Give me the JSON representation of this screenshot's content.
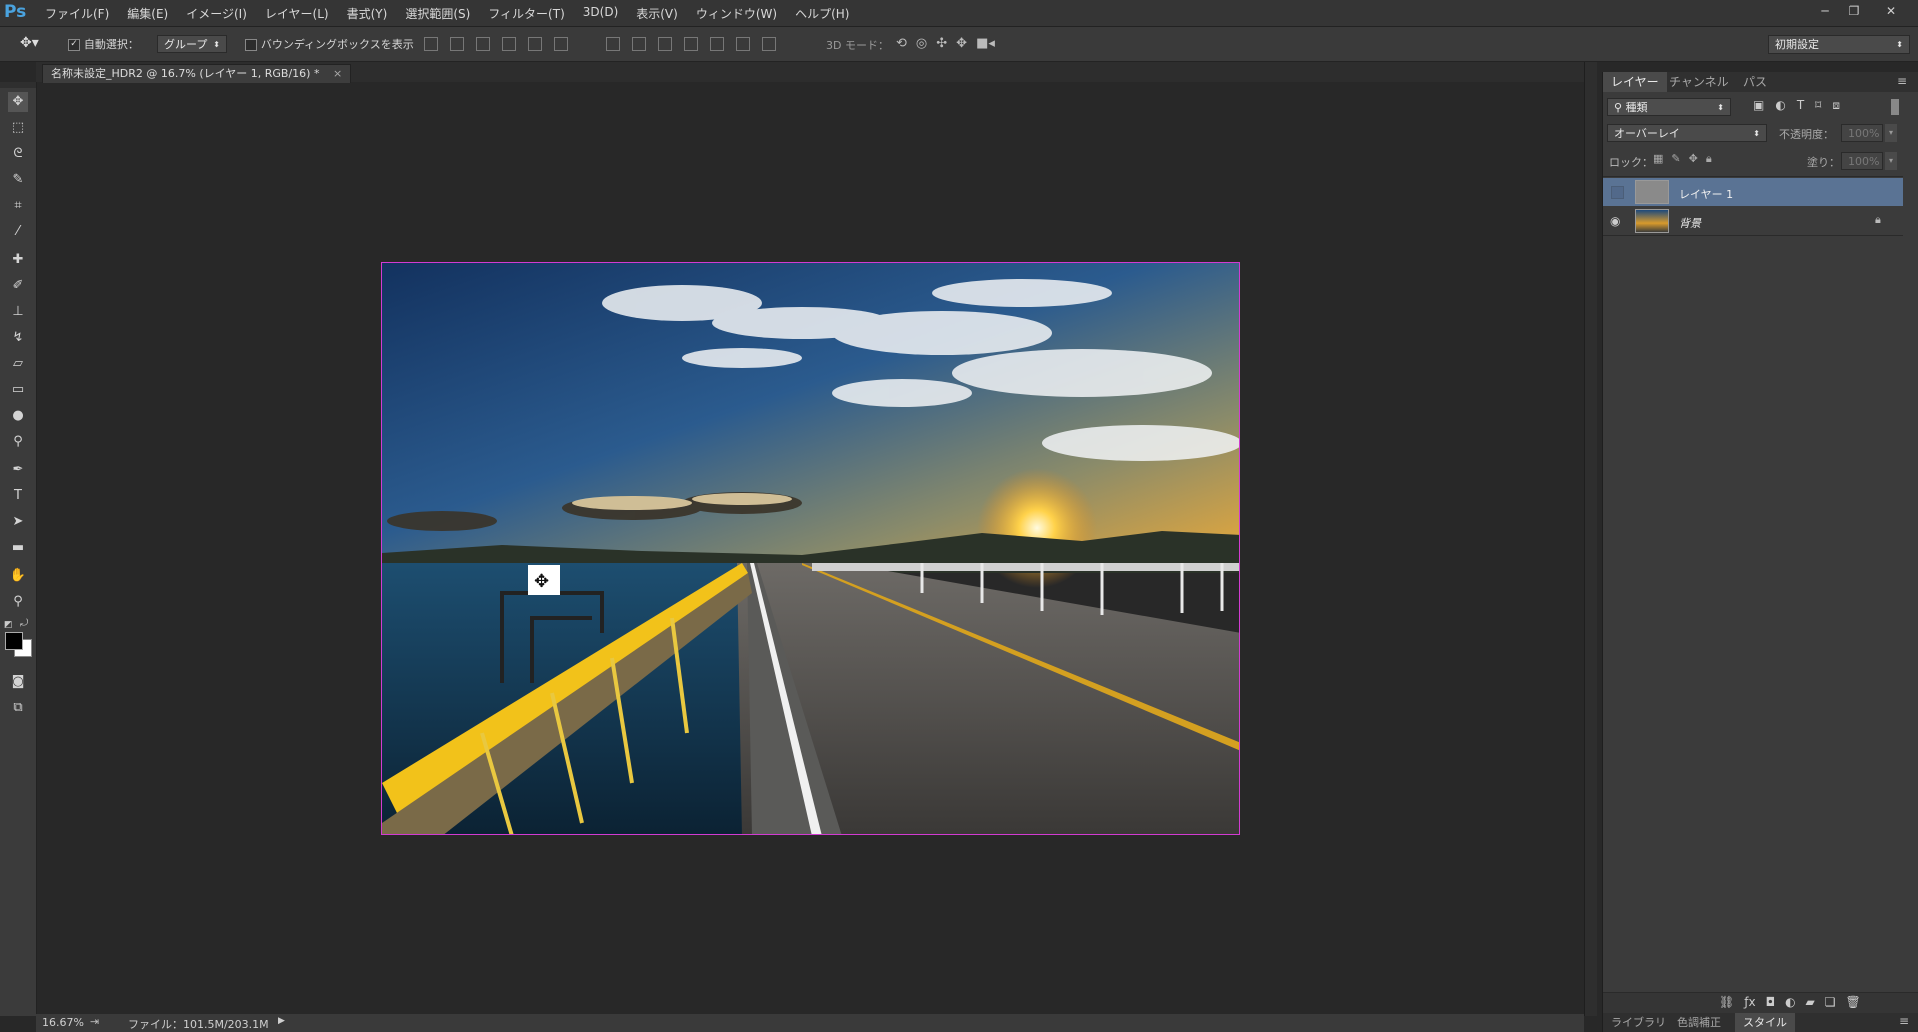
{
  "app": {
    "logo": "Ps"
  },
  "menu": [
    "ファイル(F)",
    "編集(E)",
    "イメージ(I)",
    "レイヤー(L)",
    "書式(Y)",
    "選択範囲(S)",
    "フィルター(T)",
    "3D(D)",
    "表示(V)",
    "ウィンドウ(W)",
    "ヘルプ(H)"
  ],
  "options": {
    "auto_select_label": "自動選択：",
    "auto_select_value": "グループ",
    "bounding_box_label": "バウンディングボックスを表示",
    "mode3d_label": "3D モード：",
    "workspace": "初期設定"
  },
  "document": {
    "tab_title": "名称未設定_HDR2 @ 16.7% (レイヤー 1, RGB/16) *",
    "close": "×"
  },
  "status": {
    "zoom": "16.67%",
    "file": "ファイル：101.5M/203.1M",
    "arrow": "▶"
  },
  "panel": {
    "tabs": [
      "レイヤー",
      "チャンネル",
      "パス"
    ],
    "filter_kind": "種類",
    "blend_mode": "オーバーレイ",
    "opacity_label": "不透明度：",
    "opacity_value": "100%",
    "lock_label": "ロック：",
    "fill_label": "塗り：",
    "fill_value": "100%",
    "layers": [
      {
        "name": "レイヤー 1",
        "visible": false,
        "selected": true,
        "locked": false
      },
      {
        "name": "背景",
        "visible": true,
        "selected": false,
        "locked": true
      }
    ],
    "bottom_tabs": [
      "ライブラリ",
      "色調補正",
      "スタイル"
    ],
    "bottom_icons": [
      "link-icon",
      "fx-icon",
      "mask-icon",
      "adjustment-icon",
      "folder-icon",
      "new-layer-icon",
      "trash-icon"
    ]
  },
  "colors": {
    "accent": "#5a7394",
    "canvas_border": "#d23bd2",
    "logo": "#4aa3df"
  }
}
